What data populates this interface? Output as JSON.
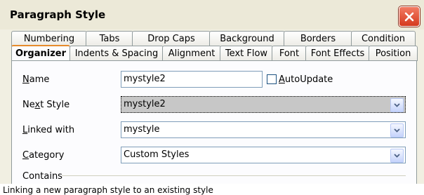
{
  "dialog": {
    "title": "Paragraph Style",
    "close_icon": "close-x-icon"
  },
  "tabs_back": [
    "Numbering",
    "Tabs",
    "Drop Caps",
    "Background",
    "Borders",
    "Condition"
  ],
  "tabs_front": [
    "Organizer",
    "Indents & Spacing",
    "Alignment",
    "Text Flow",
    "Font",
    "Font Effects",
    "Position"
  ],
  "active_tab": "Organizer",
  "form": {
    "name_label_ul": "N",
    "name_label_rest": "ame",
    "name_value": "mystyle2",
    "autoupdate_label_ul": "A",
    "autoupdate_label_rest": "utoUpdate",
    "autoupdate_checked": false,
    "next_style_label_a": "Ne",
    "next_style_label_ul": "x",
    "next_style_label_b": "t Style",
    "next_style_value": "mystyle2",
    "linked_with_label_ul": "L",
    "linked_with_label_rest": "inked with",
    "linked_with_value": "mystyle",
    "category_label_ul": "C",
    "category_label_rest": "ategory",
    "category_value": "Custom Styles",
    "contains_label": "Contains"
  },
  "caption": "Linking a new paragraph style to an existing style"
}
